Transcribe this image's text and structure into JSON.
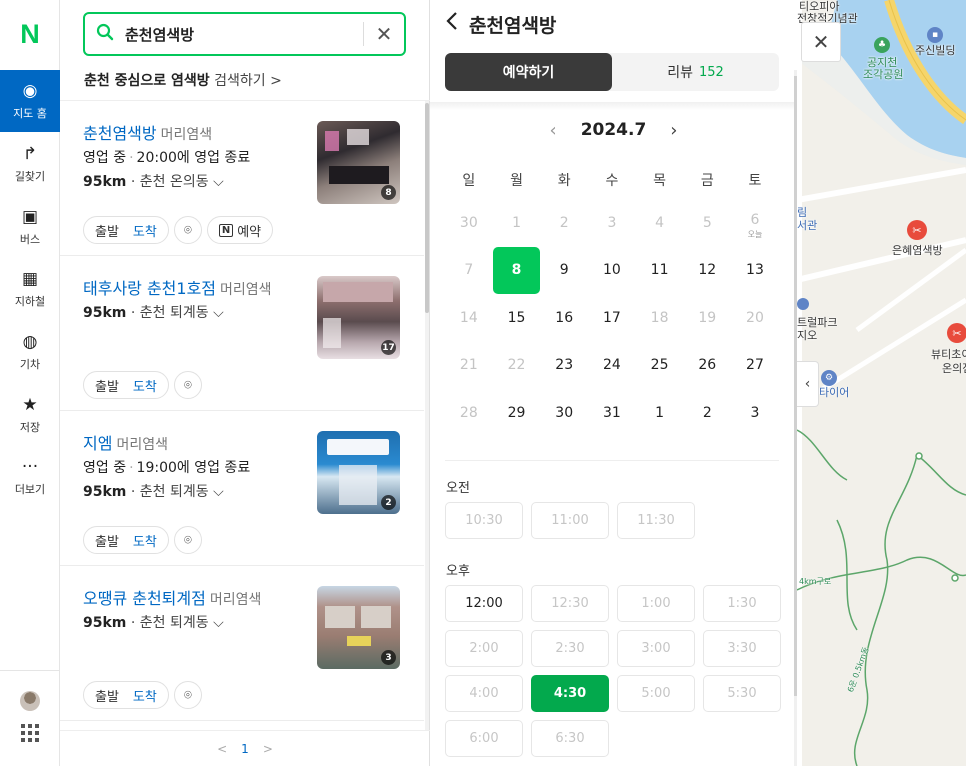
{
  "rail": {
    "logo": "N",
    "items": [
      {
        "label": "지도 홈",
        "icon": "map-pin-icon",
        "glyph": "◉"
      },
      {
        "label": "길찾기",
        "icon": "directions-icon",
        "glyph": "↱"
      },
      {
        "label": "버스",
        "icon": "bus-icon",
        "glyph": "▣"
      },
      {
        "label": "지하철",
        "icon": "subway-icon",
        "glyph": "▦"
      },
      {
        "label": "기차",
        "icon": "train-icon",
        "glyph": "◍"
      },
      {
        "label": "저장",
        "icon": "star-icon",
        "glyph": "★"
      },
      {
        "label": "더보기",
        "icon": "more-icon",
        "glyph": "···"
      }
    ]
  },
  "search": {
    "query": "춘천염색방",
    "suggest_bold": "춘천 중심으로 염색방",
    "suggest_rest": " 검색하기 >"
  },
  "results": [
    {
      "name": "춘천염색방",
      "category": "머리염색",
      "status": "영업 중",
      "hours": "20:00에 영업 종료",
      "distance": "95km",
      "area": "춘천 온의동",
      "photos": "8",
      "start": "출발",
      "arrive": "도착",
      "reserve": "예약"
    },
    {
      "name": "태후사랑 춘천1호점",
      "category": "머리염색",
      "status": "",
      "hours": "",
      "distance": "95km",
      "area": "춘천 퇴계동",
      "photos": "17",
      "start": "출발",
      "arrive": "도착",
      "reserve": ""
    },
    {
      "name": "지엠",
      "category": "머리염색",
      "status": "영업 중",
      "hours": "19:00에 영업 종료",
      "distance": "95km",
      "area": "춘천 퇴계동",
      "photos": "2",
      "start": "출발",
      "arrive": "도착",
      "reserve": ""
    },
    {
      "name": "오땡큐 춘천퇴계점",
      "category": "머리염색",
      "status": "",
      "hours": "",
      "distance": "95km",
      "area": "춘천 퇴계동",
      "photos": "3",
      "start": "출발",
      "arrive": "도착",
      "reserve": ""
    }
  ],
  "pager": {
    "prev": "<",
    "page": "1",
    "next": ">"
  },
  "detail": {
    "title": "춘천염색방",
    "tab_reserve": "예약하기",
    "tab_review": "리뷰",
    "review_count": "152",
    "month": "2024.7",
    "weekdays": [
      "일",
      "월",
      "화",
      "수",
      "목",
      "금",
      "토"
    ],
    "weeks": [
      [
        {
          "d": "30",
          "s": "dim"
        },
        {
          "d": "1",
          "s": "dim"
        },
        {
          "d": "2",
          "s": "dim"
        },
        {
          "d": "3",
          "s": "dim"
        },
        {
          "d": "4",
          "s": "dim"
        },
        {
          "d": "5",
          "s": "dim"
        },
        {
          "d": "6",
          "s": "dim",
          "sub": "오늘"
        }
      ],
      [
        {
          "d": "7",
          "s": "dim"
        },
        {
          "d": "8",
          "s": "sel"
        },
        {
          "d": "9",
          "s": ""
        },
        {
          "d": "10",
          "s": ""
        },
        {
          "d": "11",
          "s": ""
        },
        {
          "d": "12",
          "s": ""
        },
        {
          "d": "13",
          "s": ""
        }
      ],
      [
        {
          "d": "14",
          "s": "dim"
        },
        {
          "d": "15",
          "s": ""
        },
        {
          "d": "16",
          "s": ""
        },
        {
          "d": "17",
          "s": ""
        },
        {
          "d": "18",
          "s": "dim"
        },
        {
          "d": "19",
          "s": "dim"
        },
        {
          "d": "20",
          "s": "dim"
        }
      ],
      [
        {
          "d": "21",
          "s": "dim"
        },
        {
          "d": "22",
          "s": "dim"
        },
        {
          "d": "23",
          "s": ""
        },
        {
          "d": "24",
          "s": ""
        },
        {
          "d": "25",
          "s": ""
        },
        {
          "d": "26",
          "s": ""
        },
        {
          "d": "27",
          "s": ""
        }
      ],
      [
        {
          "d": "28",
          "s": "dim"
        },
        {
          "d": "29",
          "s": ""
        },
        {
          "d": "30",
          "s": ""
        },
        {
          "d": "31",
          "s": ""
        },
        {
          "d": "1",
          "s": ""
        },
        {
          "d": "2",
          "s": ""
        },
        {
          "d": "3",
          "s": ""
        }
      ]
    ],
    "am_label": "오전",
    "am_slots": [
      {
        "t": "10:30",
        "s": ""
      },
      {
        "t": "11:00",
        "s": ""
      },
      {
        "t": "11:30",
        "s": ""
      }
    ],
    "pm_label": "오후",
    "pm_slots": [
      {
        "t": "12:00",
        "s": "on"
      },
      {
        "t": "12:30",
        "s": ""
      },
      {
        "t": "1:00",
        "s": ""
      },
      {
        "t": "1:30",
        "s": ""
      },
      {
        "t": "2:00",
        "s": ""
      },
      {
        "t": "2:30",
        "s": ""
      },
      {
        "t": "3:00",
        "s": ""
      },
      {
        "t": "3:30",
        "s": ""
      },
      {
        "t": "4:00",
        "s": ""
      },
      {
        "t": "4:30",
        "s": "sel"
      },
      {
        "t": "5:00",
        "s": ""
      },
      {
        "t": "5:30",
        "s": ""
      },
      {
        "t": "6:00",
        "s": ""
      },
      {
        "t": "6:30",
        "s": ""
      }
    ]
  },
  "map": {
    "labels": {
      "top": "티오피아",
      "top2": "전창적기념관",
      "park": "공지천",
      "park2": "조각공원",
      "bldg": "주신빌딩",
      "shop1": "은혜염색방",
      "shop2": "뷰티초이",
      "shop2b": "온의점",
      "west1": "림",
      "west2": "서관",
      "west3": "트럴파크",
      "west4": "지오",
      "tire": "타이어",
      "trail1": "4km구로",
      "trail2": "6운 0.5km동"
    }
  },
  "colors": {
    "brand": "#03c75a",
    "link": "#0068c3",
    "active_rail": "#0068c3",
    "selected": "#03a94d"
  }
}
